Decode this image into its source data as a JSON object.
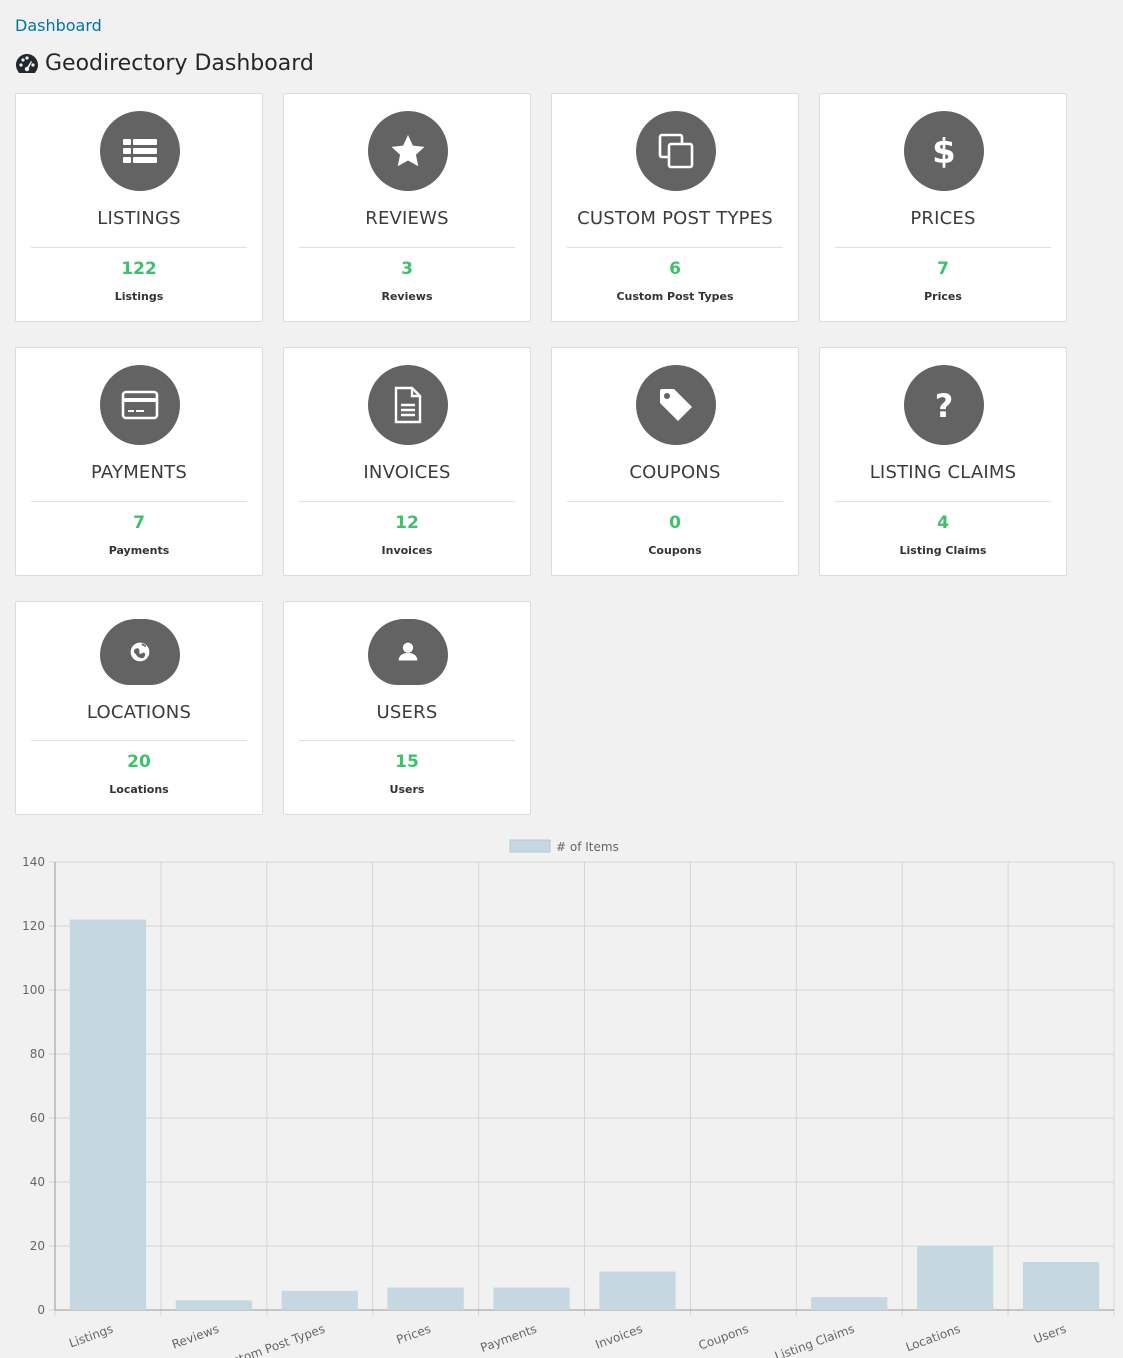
{
  "breadcrumb": "Dashboard",
  "page_title": "Geodirectory Dashboard",
  "colors": {
    "accent_link": "#0073aa",
    "count_green": "#3ec06c",
    "icon_bg": "#636363",
    "bar_fill": "#c5d7e0"
  },
  "cards": [
    {
      "title": "LISTINGS",
      "count": "122",
      "sub": "Listings",
      "icon": "list-icon"
    },
    {
      "title": "REVIEWS",
      "count": "3",
      "sub": "Reviews",
      "icon": "star-icon"
    },
    {
      "title": "CUSTOM POST TYPES",
      "count": "6",
      "sub": "Custom Post Types",
      "icon": "copy-icon"
    },
    {
      "title": "PRICES",
      "count": "7",
      "sub": "Prices",
      "icon": "dollar-icon"
    },
    {
      "title": "PAYMENTS",
      "count": "7",
      "sub": "Payments",
      "icon": "credit-card-icon"
    },
    {
      "title": "INVOICES",
      "count": "12",
      "sub": "Invoices",
      "icon": "file-text-icon"
    },
    {
      "title": "COUPONS",
      "count": "0",
      "sub": "Coupons",
      "icon": "tag-icon"
    },
    {
      "title": "LISTING CLAIMS",
      "count": "4",
      "sub": "Listing Claims",
      "icon": "question-icon"
    },
    {
      "title": "LOCATIONS",
      "count": "20",
      "sub": "Locations",
      "icon": "globe-icon"
    },
    {
      "title": "USERS",
      "count": "15",
      "sub": "Users",
      "icon": "user-icon"
    }
  ],
  "chart_data": {
    "type": "bar",
    "categories": [
      "Listings",
      "Reviews",
      "Custom Post Types",
      "Prices",
      "Payments",
      "Invoices",
      "Coupons",
      "Listing Claims",
      "Locations",
      "Users"
    ],
    "series": [
      {
        "name": "# of Items",
        "values": [
          122,
          3,
          6,
          7,
          7,
          12,
          0,
          4,
          20,
          15
        ]
      }
    ],
    "ylim": [
      0,
      140
    ],
    "yticks": [
      0,
      20,
      40,
      60,
      80,
      100,
      120,
      140
    ],
    "grid": true,
    "legend": "top-center"
  }
}
